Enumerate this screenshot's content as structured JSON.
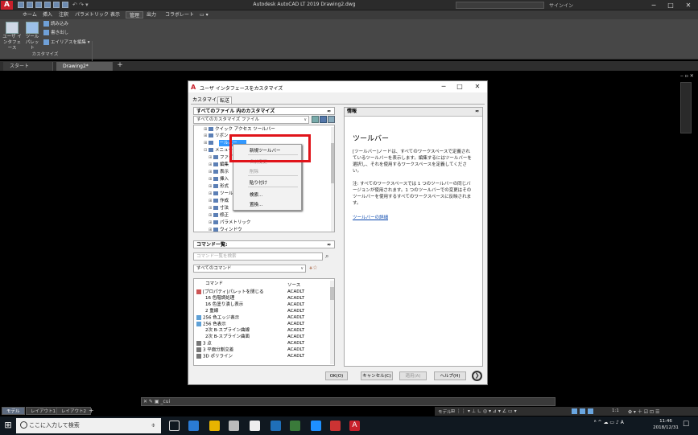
{
  "app": {
    "title": "Autodesk AutoCAD LT 2019   Drawing2.dwg",
    "logo": "A",
    "signin": "サインイン"
  },
  "ribbon": {
    "tabs": [
      "ホーム",
      "挿入",
      "注釈",
      "パラメトリック",
      "表示",
      "管理",
      "出力",
      "コラボレート"
    ],
    "active_tab": "管理",
    "buttons": {
      "cui": "ユーザ インタフェース",
      "palette": "ツール パレット",
      "load": "読み込み",
      "export": "書き出し",
      "alias": "エイリアスを編集"
    },
    "panel_title": "カスタマイズ"
  },
  "filetabs": {
    "start": "スタート",
    "drawing": "Drawing2*"
  },
  "dialog": {
    "title": "ユーザ インタフェースをカスタマイズ",
    "tabs": [
      "カスタマイズ",
      "転送"
    ],
    "customize_header": "すべてのファイル 内のカスタマイズ",
    "file_select": "すべてのカスタマイズ ファイル",
    "tree": [
      "クイック アクセス ツールバー",
      "リボン",
      "ツールバー",
      "メニュー",
      "ファイル",
      "編集",
      "表示",
      "挿入",
      "形式",
      "ツール",
      "作成",
      "寸法",
      "修正",
      "パラメトリック",
      "ウィンドウ",
      "ヘルプ",
      "クイック プロパティ"
    ],
    "context_menu": {
      "new_toolbar": "新規ツールバー",
      "rename": "名前変更",
      "delete": "削除",
      "paste": "貼り付け",
      "find": "検索...",
      "replace": "置換..."
    },
    "command_header": "コマンド一覧:",
    "command_search_placeholder": "コマンド一覧を検索",
    "command_filter": "すべてのコマンド",
    "command_cols": {
      "name": "コマンド",
      "source": "ソース"
    },
    "commands": [
      {
        "name": "[プロパティ]パレットを閉じる",
        "source": "ACADLT"
      },
      {
        "name": "16 色階調処理",
        "source": "ACADLT"
      },
      {
        "name": "16 色塗り潰し表示",
        "source": "ACADLT"
      },
      {
        "name": "2 重線",
        "source": "ACADLT"
      },
      {
        "name": "256 色エッジ表示",
        "source": "ACADLT"
      },
      {
        "name": "256 色表示",
        "source": "ACADLT"
      },
      {
        "name": "2次 B-スプライン曲線",
        "source": "ACADLT"
      },
      {
        "name": "2次 B-スプライン曲面",
        "source": "ACADLT"
      },
      {
        "name": "3 点",
        "source": "ACADLT"
      },
      {
        "name": "3 平面分割交差",
        "source": "ACADLT"
      },
      {
        "name": "3D ポリライン",
        "source": "ACADLT"
      }
    ],
    "info_header": "情報",
    "info_title": "ツールバー",
    "info_p1": "[ツールバー]ノードは、すべてのワークスペースで定義されているツールバーを表示します。編集するにはツールバーを選択し、それを使用するワークスペースを定義してください。",
    "info_p2": "注: すべてのワークスペースでは 1 つのツールバーの同じバージョンが使用されます。1 つのツールバーでの変更はそのツールバーを使用するすべてのワークスペースに反映されます。",
    "info_link": "ツールバーの詳細",
    "buttons": {
      "ok": "OK(O)",
      "cancel": "キャンセル(C)",
      "apply": "適用(A)",
      "help": "ヘルプ(H)"
    }
  },
  "command_line": {
    "text": "_cui"
  },
  "layout_tabs": [
    "モデル",
    "レイアウト1",
    "レイアウト2"
  ],
  "status": {
    "model": "モデル",
    "scale": "1:1"
  },
  "taskbar": {
    "search_placeholder": "ここに入力して検索",
    "time": "11:46",
    "date": "2018/12/31",
    "ime": "A"
  }
}
